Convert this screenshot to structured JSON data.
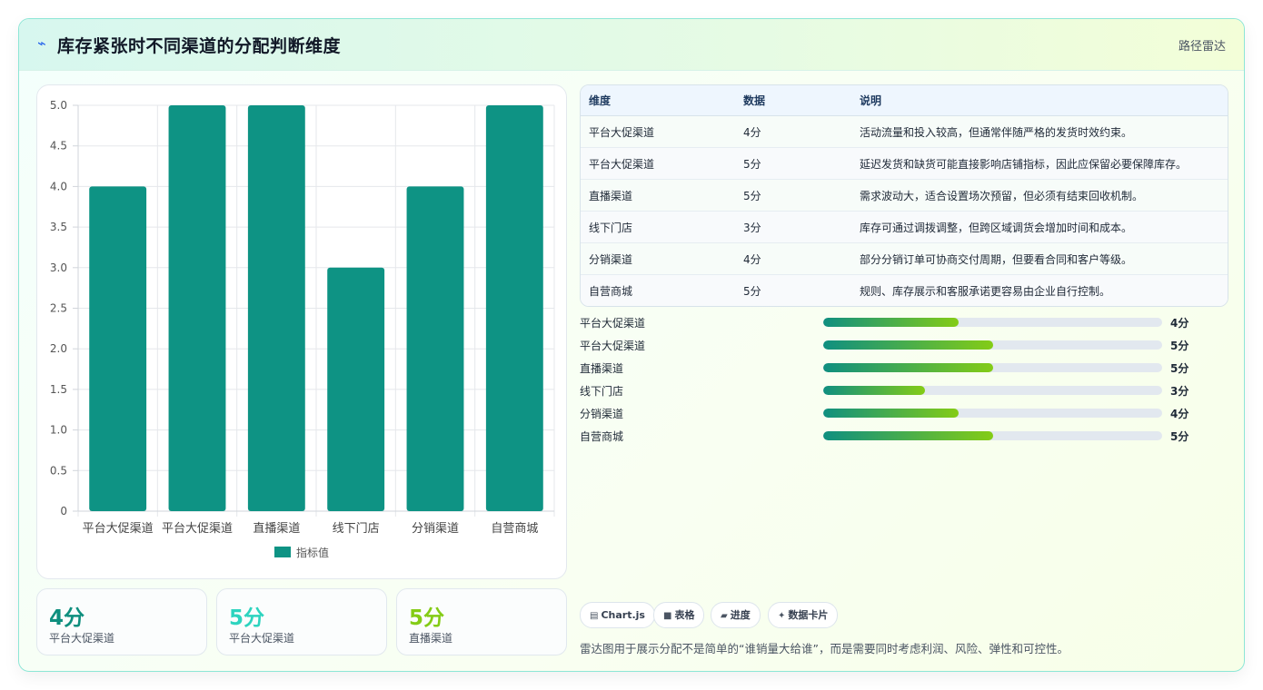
{
  "header": {
    "icon": "sparkle-icon",
    "title": "库存紧张时不同渠道的分配判断维度",
    "right_label": "路径雷达"
  },
  "chart_data": {
    "type": "bar",
    "categories": [
      "平台大促渠道",
      "平台大促渠道",
      "直播渠道",
      "线下门店",
      "分销渠道",
      "自营商城"
    ],
    "series": [
      {
        "name": "指标值",
        "values": [
          4,
          5,
          5,
          3,
          4,
          5
        ],
        "color": "#0e9384"
      }
    ],
    "ylim": [
      0,
      5
    ],
    "yticks": [
      "0",
      "0.5",
      "1.0",
      "1.5",
      "2.0",
      "2.5",
      "3.0",
      "3.5",
      "4.0",
      "4.5",
      "5.0"
    ],
    "grid": true,
    "legend": "bottom"
  },
  "stats": [
    {
      "value": "4分",
      "label": "平台大促渠道",
      "color": "#0e8f7e"
    },
    {
      "value": "5分",
      "label": "平台大促渠道",
      "color": "#2dd4bf"
    },
    {
      "value": "5分",
      "label": "直播渠道",
      "color": "#84cc16"
    }
  ],
  "table": {
    "headers": [
      "维度",
      "数据",
      "说明"
    ],
    "rows": [
      [
        "平台大促渠道",
        "4分",
        "活动流量和投入较高，但通常伴随严格的发货时效约束。"
      ],
      [
        "平台大促渠道",
        "5分",
        "延迟发货和缺货可能直接影响店铺指标，因此应保留必要保障库存。"
      ],
      [
        "直播渠道",
        "5分",
        "需求波动大，适合设置场次预留，但必须有结束回收机制。"
      ],
      [
        "线下门店",
        "3分",
        "库存可通过调拨调整，但跨区域调货会增加时间和成本。"
      ],
      [
        "分销渠道",
        "4分",
        "部分分销订单可协商交付周期，但要看合同和客户等级。"
      ],
      [
        "自营商城",
        "5分",
        "规则、库存展示和客服承诺更容易由企业自行控制。"
      ]
    ]
  },
  "progress": {
    "max": 10,
    "items": [
      {
        "label": "平台大促渠道",
        "value": 4,
        "display": "4分"
      },
      {
        "label": "平台大促渠道",
        "value": 5,
        "display": "5分"
      },
      {
        "label": "直播渠道",
        "value": 5,
        "display": "5分"
      },
      {
        "label": "线下门店",
        "value": 3,
        "display": "3分"
      },
      {
        "label": "分销渠道",
        "value": 4,
        "display": "4分"
      },
      {
        "label": "自营商城",
        "value": 5,
        "display": "5分"
      }
    ]
  },
  "chips": [
    {
      "icon": "chart-icon",
      "glyph": "▤",
      "label": "Chart.js"
    },
    {
      "icon": "table-icon",
      "glyph": "■",
      "label": "表格"
    },
    {
      "icon": "progress-icon",
      "glyph": "▰",
      "label": "进度"
    },
    {
      "icon": "card-icon",
      "glyph": "✦",
      "label": "数据卡片"
    }
  ],
  "note": "雷达图用于展示分配不是简单的“谁销量大给谁”，而是需要同时考虑利润、风险、弹性和可控性。"
}
